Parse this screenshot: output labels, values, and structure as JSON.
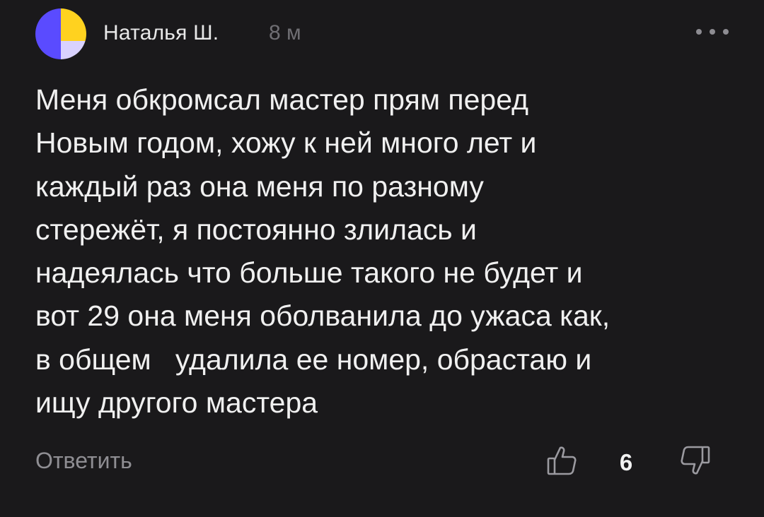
{
  "comment": {
    "author": "Наталья Ш.",
    "time": "8 м",
    "avatar_colors": {
      "left": "#5a4bff",
      "top_right": "#ffd21f",
      "bottom_right": "#d9d2ff"
    },
    "text": "Меня обкромсал мастер прям перед\nНовым годом, хожу к ней много лет и\nкаждый раз она меня по разному\nстережёт, я постоянно злилась и\nнадеялась что больше такого не будет и\nвот 29 она меня оболванила до ужаса как,\nв общем   удалила ее номер, обрастаю и\nищу другого мастера",
    "actions": {
      "reply_label": "Ответить",
      "like_icon": "thumbs-up-icon",
      "like_count": "6",
      "dislike_icon": "thumbs-down-icon",
      "more_icon": "more-horizontal-icon"
    }
  }
}
